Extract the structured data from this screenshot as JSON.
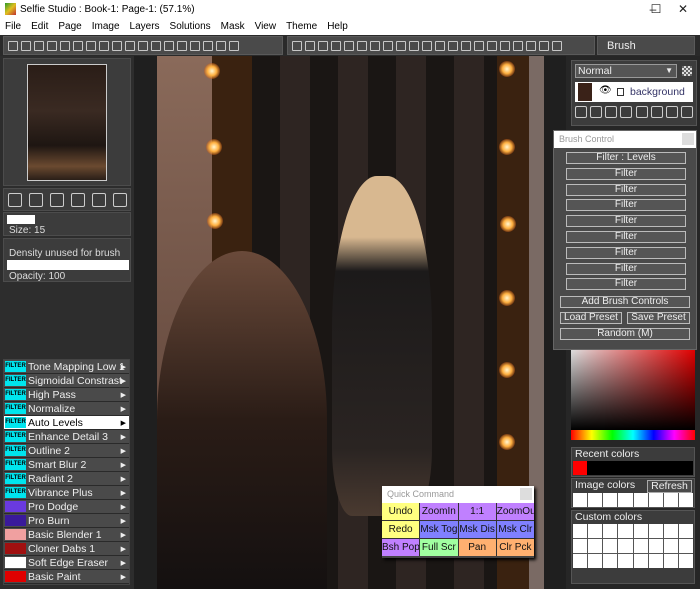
{
  "window": {
    "title": "Selfie Studio : Book-1: Page-1:  (57.1%)",
    "minimize": "–",
    "maximize": "☐",
    "close": "✕"
  },
  "menu": [
    "File",
    "Edit",
    "Page",
    "Image",
    "Layers",
    "Solutions",
    "Mask",
    "View",
    "Theme",
    "Help"
  ],
  "toolbar": {
    "brush_field": "Brush"
  },
  "left": {
    "size_label": "Size: 15",
    "density_label": "Density unused for brush",
    "opacity_label": "Opacity: 100"
  },
  "filters": [
    {
      "label": "Tone Mapping Low 1",
      "type": "filter",
      "badge": "FILTER"
    },
    {
      "label": "Sigmoidal Constrast",
      "type": "filter",
      "badge": "FILTER"
    },
    {
      "label": "High Pass",
      "type": "filter",
      "badge": "FILTER"
    },
    {
      "label": "Normalize",
      "type": "filter",
      "badge": "FILTER"
    },
    {
      "label": "Auto Levels",
      "type": "filter",
      "badge": "FILTER",
      "selected": true
    },
    {
      "label": "Enhance Detail 3",
      "type": "filter",
      "badge": "FILTER"
    },
    {
      "label": "Outline 2",
      "type": "filter",
      "badge": "FILTER"
    },
    {
      "label": "Smart Blur 2",
      "type": "filter",
      "badge": "FILTER"
    },
    {
      "label": "Radiant 2",
      "type": "filter",
      "badge": "FILTER"
    },
    {
      "label": "Vibrance Plus",
      "type": "filter",
      "badge": "FILTER"
    },
    {
      "label": "Pro Dodge",
      "type": "brush",
      "color": "#6a3adf"
    },
    {
      "label": "Pro Burn",
      "type": "brush",
      "color": "#3a1a9a"
    },
    {
      "label": "Basic Blender 1",
      "type": "brush",
      "color": "#f0a0a0"
    },
    {
      "label": "Cloner Dabs 1",
      "type": "brush",
      "color": "#a01010"
    },
    {
      "label": "Soft Edge Eraser",
      "type": "brush",
      "color": "#ffffff"
    },
    {
      "label": "Basic Paint",
      "type": "brush",
      "color": "#e00000"
    }
  ],
  "layers": {
    "blend_mode": "Normal",
    "layer_name": "background"
  },
  "brush_control": {
    "title": "Brush Control",
    "filters": [
      "Filter : Levels",
      "Filter",
      "Filter",
      "Filter",
      "Filter",
      "Filter",
      "Filter",
      "Filter",
      "Filter"
    ],
    "add": "Add Brush Controls",
    "load": "Load Preset",
    "save": "Save Preset",
    "random": "Random (M)"
  },
  "colors": {
    "recent_label": "Recent colors",
    "recent": [
      "#ff0000"
    ],
    "image_label": "Image colors",
    "refresh": "Refresh",
    "custom_label": "Custom colors"
  },
  "quick_command": {
    "title": "Quick Command",
    "buttons": [
      {
        "label": "Undo",
        "color": "#ffff80"
      },
      {
        "label": "ZoomIn",
        "color": "#c080ff"
      },
      {
        "label": "1:1",
        "color": "#c080ff"
      },
      {
        "label": "ZoomOut",
        "color": "#c080ff"
      },
      {
        "label": "Redo",
        "color": "#ffff80"
      },
      {
        "label": "Msk Tog",
        "color": "#8080ff"
      },
      {
        "label": "Msk Dis",
        "color": "#8080ff"
      },
      {
        "label": "Msk Clr",
        "color": "#8080ff"
      },
      {
        "label": "Bsh Pop",
        "color": "#c080ff"
      },
      {
        "label": "Full Scr",
        "color": "#a0ffa0"
      },
      {
        "label": "Pan",
        "color": "#ffb070"
      },
      {
        "label": "Clr Pck",
        "color": "#ffb070"
      }
    ]
  }
}
